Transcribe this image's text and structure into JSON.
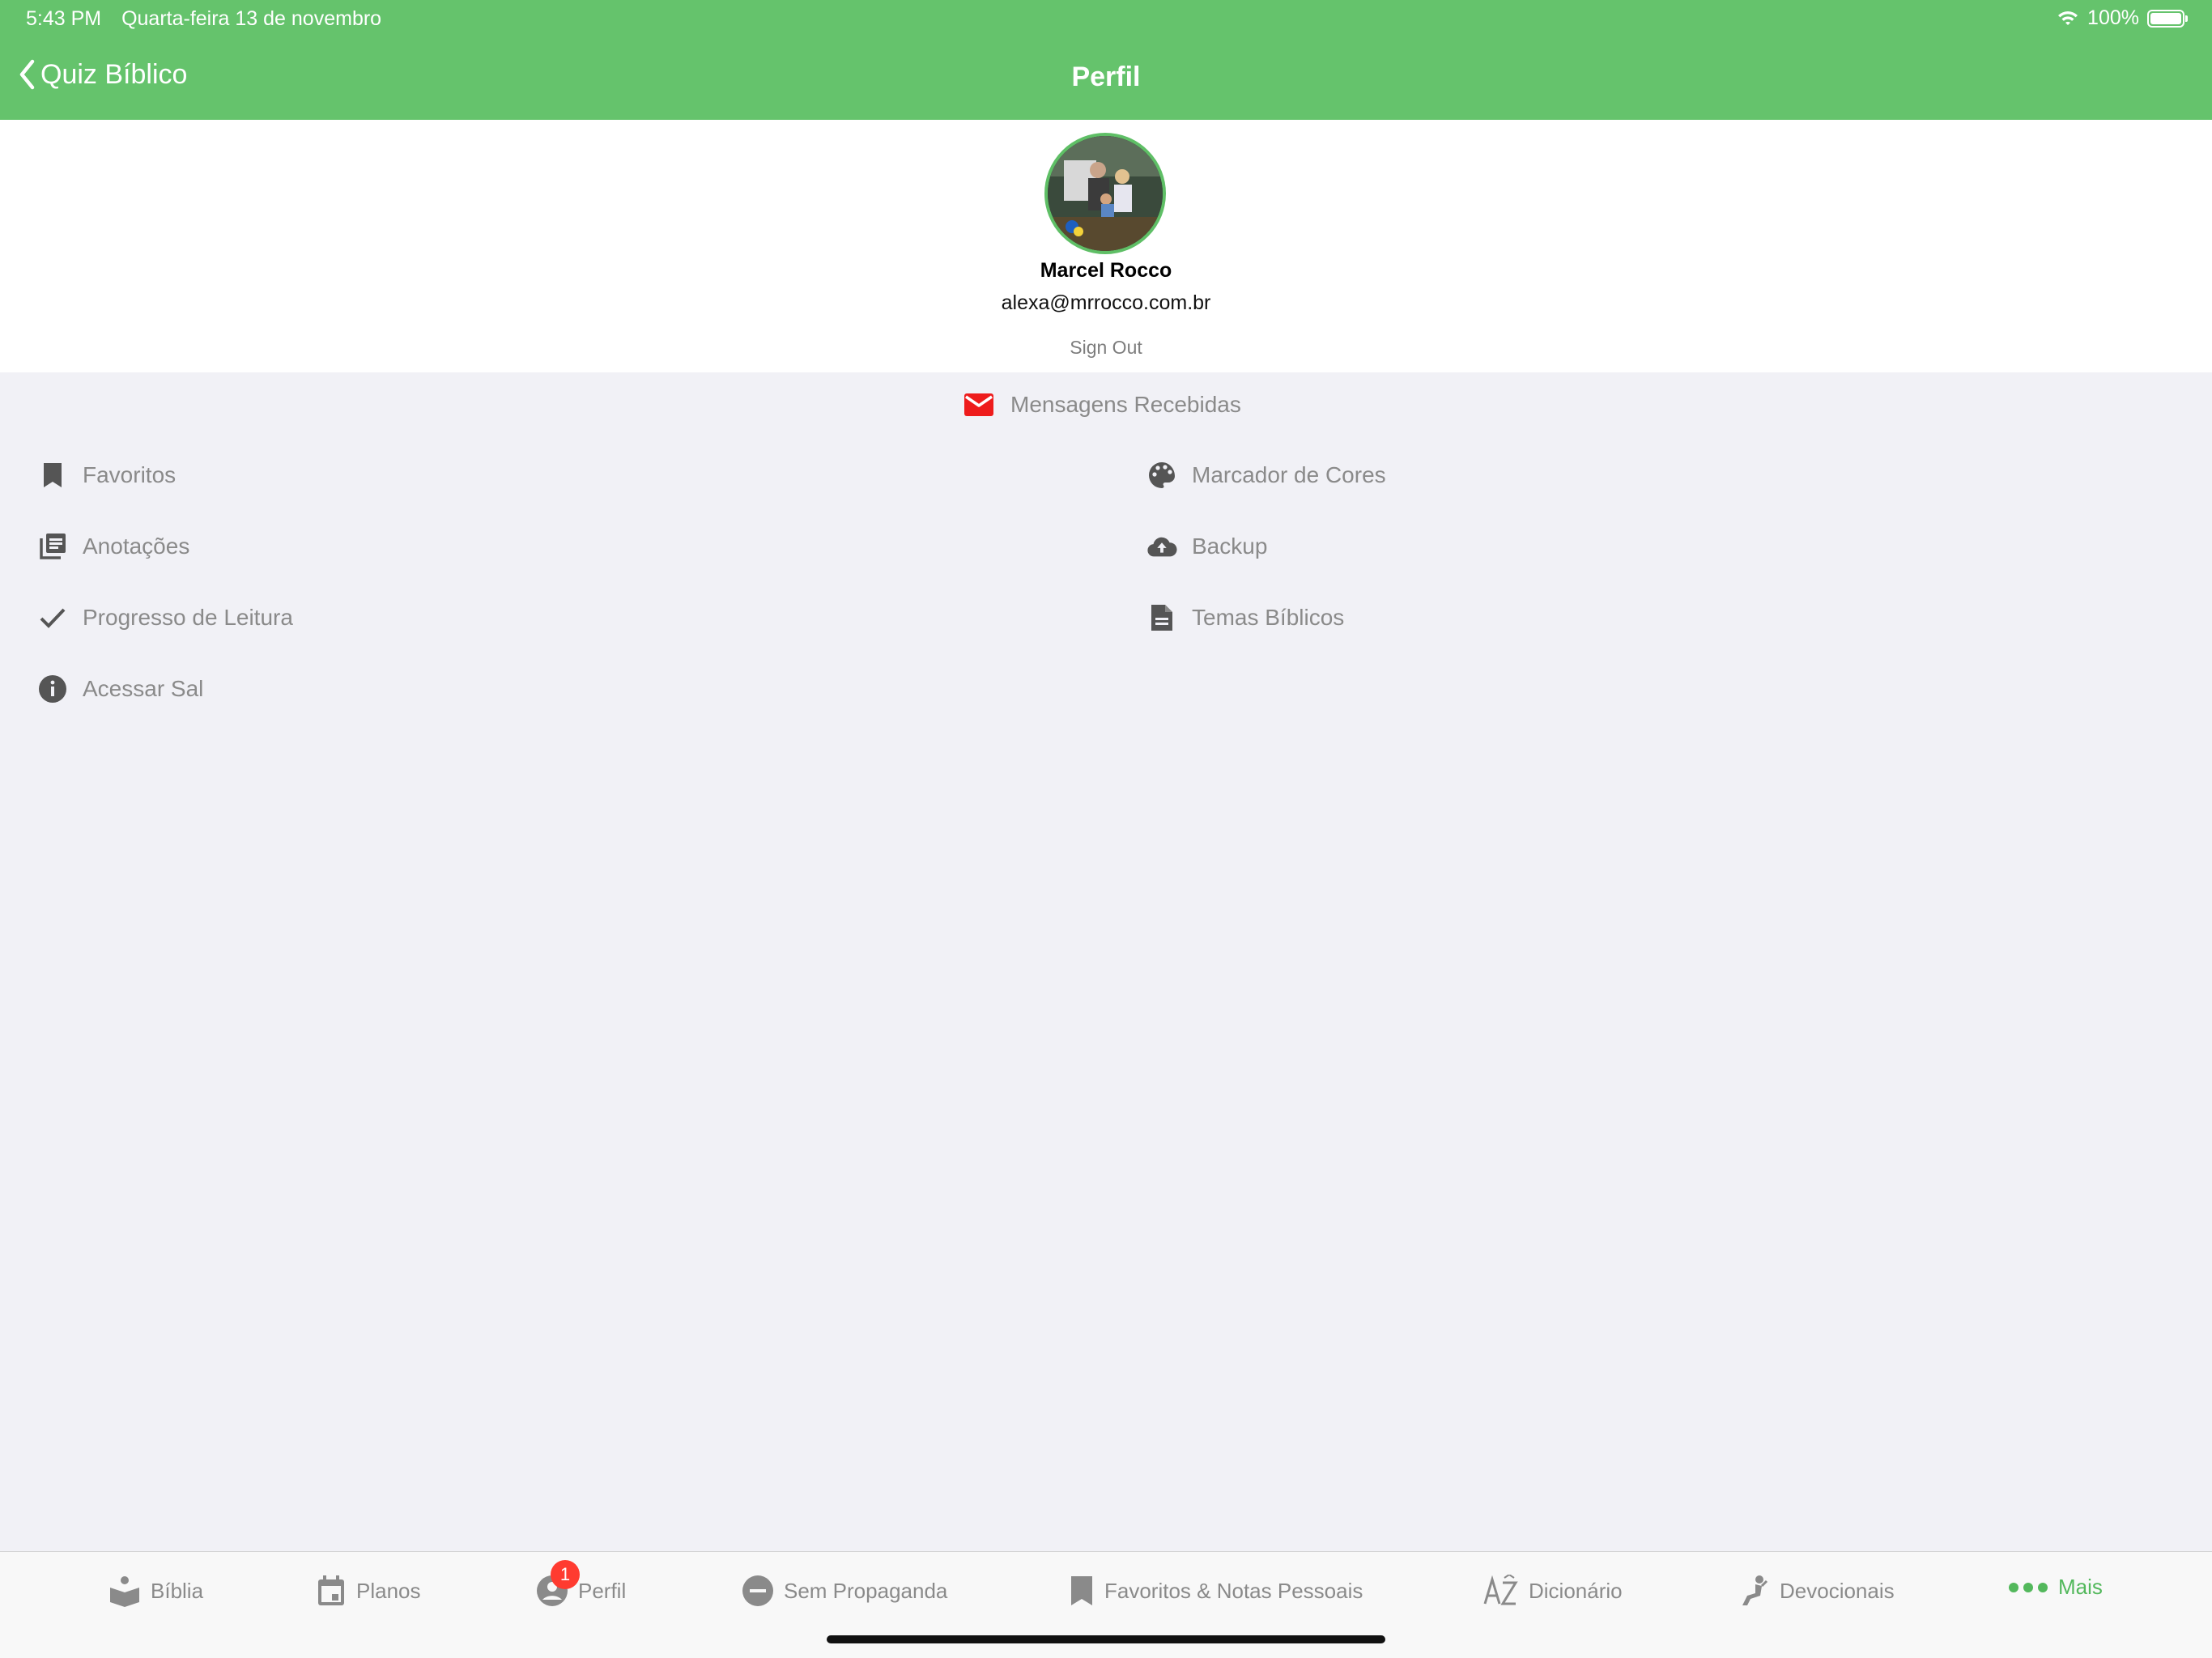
{
  "status_bar": {
    "time": "5:43 PM",
    "date": "Quarta-feira 13 de novembro",
    "battery": "100%",
    "icons": [
      "wifi-icon",
      "battery-icon"
    ]
  },
  "nav": {
    "back_label": "Quiz Bíblico",
    "title": "Perfil"
  },
  "profile": {
    "name": "Marcel Rocco",
    "email": "alexa@mrrocco.com.br",
    "sign_out": "Sign Out"
  },
  "menu": {
    "messages": {
      "label": "Mensagens Recebidas",
      "icon": "mail-icon",
      "icon_color": "#ee1c1c"
    },
    "left": [
      {
        "label": "Favoritos",
        "icon": "bookmark-icon"
      },
      {
        "label": "Anotações",
        "icon": "notes-icon"
      },
      {
        "label": "Progresso de Leitura",
        "icon": "check-icon"
      },
      {
        "label": "Acessar Sal",
        "icon": "info-icon"
      }
    ],
    "right": [
      {
        "label": "Marcador de Cores",
        "icon": "palette-icon"
      },
      {
        "label": "Backup",
        "icon": "cloud-upload-icon"
      },
      {
        "label": "Temas Bíblicos",
        "icon": "document-icon"
      }
    ]
  },
  "tabs": [
    {
      "label": "Bíblia",
      "icon": "bible-icon"
    },
    {
      "label": "Planos",
      "icon": "calendar-icon"
    },
    {
      "label": "Perfil",
      "icon": "profile-icon",
      "badge": "1"
    },
    {
      "label": "Sem Propaganda",
      "icon": "no-ads-icon"
    },
    {
      "label": "Favoritos & Notas Pessoais",
      "icon": "bookmark-icon"
    },
    {
      "label": "Dicionário",
      "icon": "az-icon"
    },
    {
      "label": "Devocionais",
      "icon": "praying-icon"
    },
    {
      "label": "Mais",
      "icon": "more-dots-icon",
      "active": true
    }
  ],
  "colors": {
    "brand_green": "#65c36c",
    "active_tab": "#53b85c",
    "badge_red": "#ff3b30",
    "muted_text": "#8a8a8a",
    "background": "#f1f1f6"
  }
}
